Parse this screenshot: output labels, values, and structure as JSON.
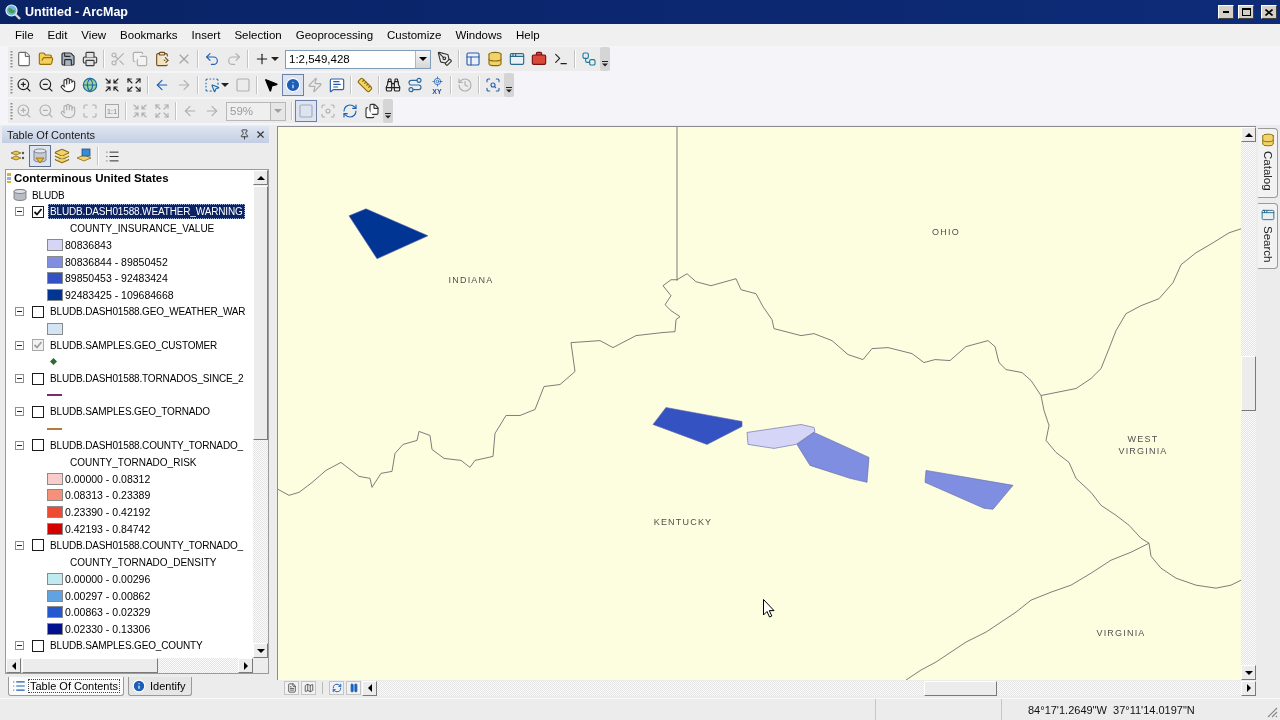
{
  "window": {
    "title": "Untitled - ArcMap"
  },
  "menu": [
    "File",
    "Edit",
    "View",
    "Bookmarks",
    "Insert",
    "Selection",
    "Geoprocessing",
    "Customize",
    "Windows",
    "Help"
  ],
  "toolbars": [
    {
      "buttons": [
        {
          "disabled": false,
          "selected": false
        },
        {
          "disabled": false,
          "selected": false
        },
        {
          "disabled": false,
          "selected": false
        },
        {
          "disabled": false,
          "selected": false
        },
        {
          "disabled": true,
          "selected": false
        },
        {
          "disabled": true,
          "selected": false
        },
        {
          "disabled": false,
          "selected": false
        },
        {
          "disabled": true,
          "selected": false
        },
        {
          "disabled": false,
          "selected": false
        },
        {
          "disabled": true,
          "selected": false
        },
        {
          "disabled": false,
          "selected": false
        },
        {
          "disabled": false,
          "selected": false
        },
        {
          "disabled": false,
          "selected": false
        },
        {
          "disabled": false,
          "selected": false
        },
        {
          "disabled": false,
          "selected": false
        },
        {
          "disabled": false,
          "selected": false
        },
        {
          "disabled": false,
          "selected": false
        },
        {
          "disabled": false,
          "selected": false
        }
      ],
      "scale": {
        "value": "1:2,549,428"
      }
    },
    {
      "buttons": [
        {
          "disabled": false,
          "selected": false
        },
        {
          "disabled": false,
          "selected": false
        },
        {
          "disabled": false,
          "selected": false
        },
        {
          "disabled": false,
          "selected": false
        },
        {
          "disabled": false,
          "selected": false
        },
        {
          "disabled": false,
          "selected": false
        },
        {
          "disabled": false,
          "selected": false
        },
        {
          "disabled": true,
          "selected": false
        },
        {
          "disabled": false,
          "selected": false
        },
        {
          "disabled": true,
          "selected": false
        },
        {
          "disabled": false,
          "selected": false
        },
        {
          "disabled": false,
          "selected": true
        },
        {
          "disabled": true,
          "selected": false
        },
        {
          "disabled": false,
          "selected": false
        },
        {
          "disabled": false,
          "selected": false
        },
        {
          "disabled": false,
          "selected": false
        },
        {
          "disabled": false,
          "selected": false
        },
        {
          "disabled": false,
          "selected": false,
          "text": "XY"
        },
        {
          "disabled": true,
          "selected": false
        },
        {
          "disabled": false,
          "selected": false
        }
      ]
    },
    {
      "buttons": [
        {
          "disabled": true,
          "selected": false
        },
        {
          "disabled": true,
          "selected": false
        },
        {
          "disabled": true,
          "selected": false
        },
        {
          "disabled": true,
          "selected": false
        },
        {
          "disabled": true,
          "selected": false,
          "text": "1:1"
        },
        {
          "disabled": true,
          "selected": false
        },
        {
          "disabled": true,
          "selected": false
        },
        {
          "disabled": true,
          "selected": false
        },
        {
          "disabled": true,
          "selected": false
        },
        {
          "disabled": true,
          "selected": true
        },
        {
          "disabled": true,
          "selected": false
        },
        {
          "disabled": false,
          "selected": false
        },
        {
          "disabled": false,
          "selected": false
        }
      ],
      "zoom": {
        "value": "59%",
        "disabled": true
      }
    }
  ],
  "toc": {
    "title": "Table Of Contents",
    "view_buttons": [
      {
        "selected": false
      },
      {
        "selected": true
      },
      {
        "selected": false
      },
      {
        "selected": false
      }
    ],
    "tree": [
      {
        "kind": "data_frame",
        "name": "Conterminous United States",
        "selected": false,
        "children": [
          {
            "kind": "database",
            "name": "BLUDB",
            "selected": false,
            "children": [
              {
                "kind": "layer",
                "name": "BLUDB.DASH01588.WEATHER_WARNING",
                "expanded": true,
                "checked": true,
                "disabled": false,
                "selected": true,
                "field": "COUNTY_INSURANCE_VALUE",
                "legend": [
                  {
                    "kind": "fill",
                    "label": "80836843",
                    "color": "#d5d5f7"
                  },
                  {
                    "kind": "fill",
                    "label": "80836844 - 89850452",
                    "color": "#7f8ee0"
                  },
                  {
                    "kind": "fill",
                    "label": "89850453 - 92483424",
                    "color": "#3552c2"
                  },
                  {
                    "kind": "fill",
                    "label": "92483425 - 109684668",
                    "color": "#003594"
                  }
                ]
              },
              {
                "kind": "layer",
                "name": "BLUDB.DASH01588.GEO_WEATHER_WAR",
                "expanded": true,
                "checked": false,
                "disabled": false,
                "selected": false,
                "legend": [
                  {
                    "kind": "fill",
                    "color": "#d3e4f5"
                  }
                ]
              },
              {
                "kind": "layer",
                "name": "BLUDB.SAMPLES.GEO_CUSTOMER",
                "expanded": true,
                "checked": true,
                "disabled": true,
                "selected": false,
                "legend": [
                  {
                    "kind": "marker",
                    "color": "#2f6b2f"
                  }
                ]
              },
              {
                "kind": "layer",
                "name": "BLUDB.DASH01588.TORNADOS_SINCE_2",
                "expanded": true,
                "checked": false,
                "disabled": false,
                "selected": false,
                "legend": [
                  {
                    "kind": "line",
                    "color": "#7d2a6e"
                  }
                ]
              },
              {
                "kind": "layer",
                "name": "BLUDB.SAMPLES.GEO_TORNADO",
                "expanded": true,
                "checked": false,
                "disabled": false,
                "selected": false,
                "legend": [
                  {
                    "kind": "line",
                    "color": "#b57b3b"
                  }
                ]
              },
              {
                "kind": "layer",
                "name": "BLUDB.DASH01588.COUNTY_TORNADO_",
                "expanded": true,
                "checked": false,
                "disabled": false,
                "selected": false,
                "field": "COUNTY_TORNADO_RISK",
                "legend": [
                  {
                    "kind": "fill",
                    "label": "0.00000 - 0.08312",
                    "color": "#f9cccc"
                  },
                  {
                    "kind": "fill",
                    "label": "0.08313 - 0.23389",
                    "color": "#f5907a"
                  },
                  {
                    "kind": "fill",
                    "label": "0.23390 - 0.42192",
                    "color": "#ef4a32"
                  },
                  {
                    "kind": "fill",
                    "label": "0.42193 - 0.84742",
                    "color": "#d40000"
                  }
                ]
              },
              {
                "kind": "layer",
                "name": "BLUDB.DASH01588.COUNTY_TORNADO_",
                "expanded": true,
                "checked": false,
                "disabled": false,
                "selected": false,
                "field": "COUNTY_TORNADO_DENSITY",
                "legend": [
                  {
                    "kind": "fill",
                    "label": "0.00000 - 0.00296",
                    "color": "#bfeaf0"
                  },
                  {
                    "kind": "fill",
                    "label": "0.00297 - 0.00862",
                    "color": "#5fa3e3"
                  },
                  {
                    "kind": "fill",
                    "label": "0.00863 - 0.02329",
                    "color": "#2458cf"
                  },
                  {
                    "kind": "fill",
                    "label": "0.02330 - 0.13306",
                    "color": "#00128f"
                  }
                ]
              },
              {
                "kind": "layer",
                "name": "BLUDB.SAMPLES.GEO_COUNTY",
                "expanded": true,
                "checked": false,
                "disabled": false,
                "selected": false
              }
            ]
          }
        ]
      }
    ],
    "tabs": [
      {
        "label": "Table Of Contents",
        "selected": true
      },
      {
        "label": "Identify",
        "selected": false
      }
    ]
  },
  "map": {
    "labels": [
      "INDIANA",
      "OHIO",
      "KENTUCKY",
      "WEST VIRGINIA",
      "VIRGINIA"
    ]
  },
  "side_tabs": [
    {
      "label": "Catalog"
    },
    {
      "label": "Search"
    }
  ],
  "status_bar": {
    "coordinates": "84°17'1.2649\"W  37°11'14.0197\"N"
  }
}
